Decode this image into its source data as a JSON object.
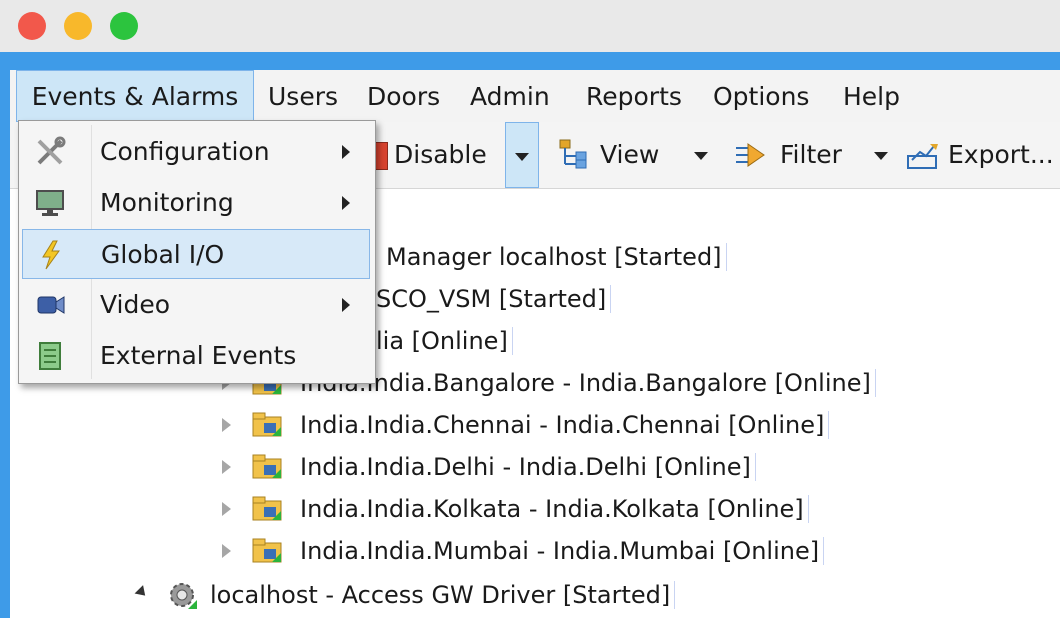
{
  "menubar": {
    "items": [
      "Events & Alarms",
      "Users",
      "Doors",
      "Admin",
      "Reports",
      "Options",
      "Help"
    ]
  },
  "toolbar": {
    "disable_label": "Disable",
    "view_label": "View",
    "filter_label": "Filter",
    "export_label": "Export..."
  },
  "dropdown_menu": {
    "items": [
      {
        "label": "Configuration",
        "icon": "tools-icon",
        "submenu": true
      },
      {
        "label": "Monitoring",
        "icon": "monitor-icon",
        "submenu": true
      },
      {
        "label": "Global I/O",
        "icon": "lightning-icon",
        "submenu": false,
        "highlighted": true
      },
      {
        "label": "Video",
        "icon": "video-camera-icon",
        "submenu": true
      },
      {
        "label": "External Events",
        "icon": "document-icon",
        "submenu": false
      }
    ]
  },
  "tree": {
    "rows": [
      "Manager localhost [Started]",
      "SCO_VSM [Started]",
      "lia [Online]",
      "India.India.Bangalore - India.Bangalore [Online]",
      "India.India.Chennai - India.Chennai [Online]",
      "India.India.Delhi - India.Delhi [Online]",
      "India.India.Kolkata - India.Kolkata [Online]",
      "India.India.Mumbai - India.Mumbai [Online]",
      "localhost - Access GW Driver [Started]"
    ]
  },
  "colors": {
    "accent_blue": "#3e9be8",
    "highlight": "#d7e9f8"
  }
}
